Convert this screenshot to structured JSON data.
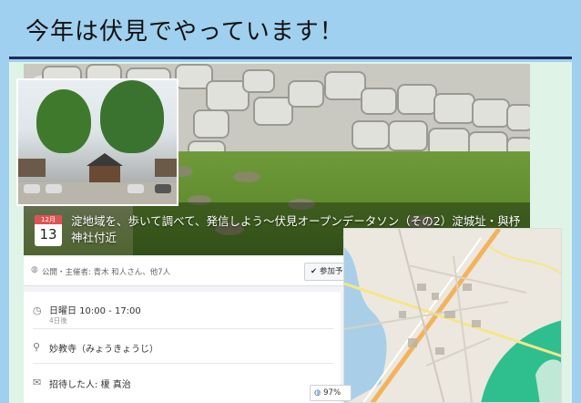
{
  "slide": {
    "title": "今年は伏見でやっています！"
  },
  "event": {
    "date_month": "12月",
    "date_day": "13",
    "name": "淀地域を、歩いて調べて、発信しよう〜伏見オープンデータソン（その2）淀城址・與杼神社付近",
    "visibility_line": "公開・主催者: 青木 和人さん、他7人",
    "join_label": "参加予",
    "time_main": "日曜日 10:00 - 17:00",
    "time_sub": "4日後",
    "location_main": "妙教寺（みょうきょうじ）",
    "invited_main": "招待した人: 榎 真治",
    "zoom_level": "97%"
  },
  "icons": {
    "globe": "globe-icon",
    "check": "check-icon",
    "clock": "clock-icon",
    "pin": "map-pin-icon",
    "mail": "mail-icon"
  },
  "colors": {
    "slide_bg": "#9fd0ef",
    "title_rule": "#1e2a5a",
    "date_red": "#e05252",
    "map_green": "#2fbf8f"
  }
}
